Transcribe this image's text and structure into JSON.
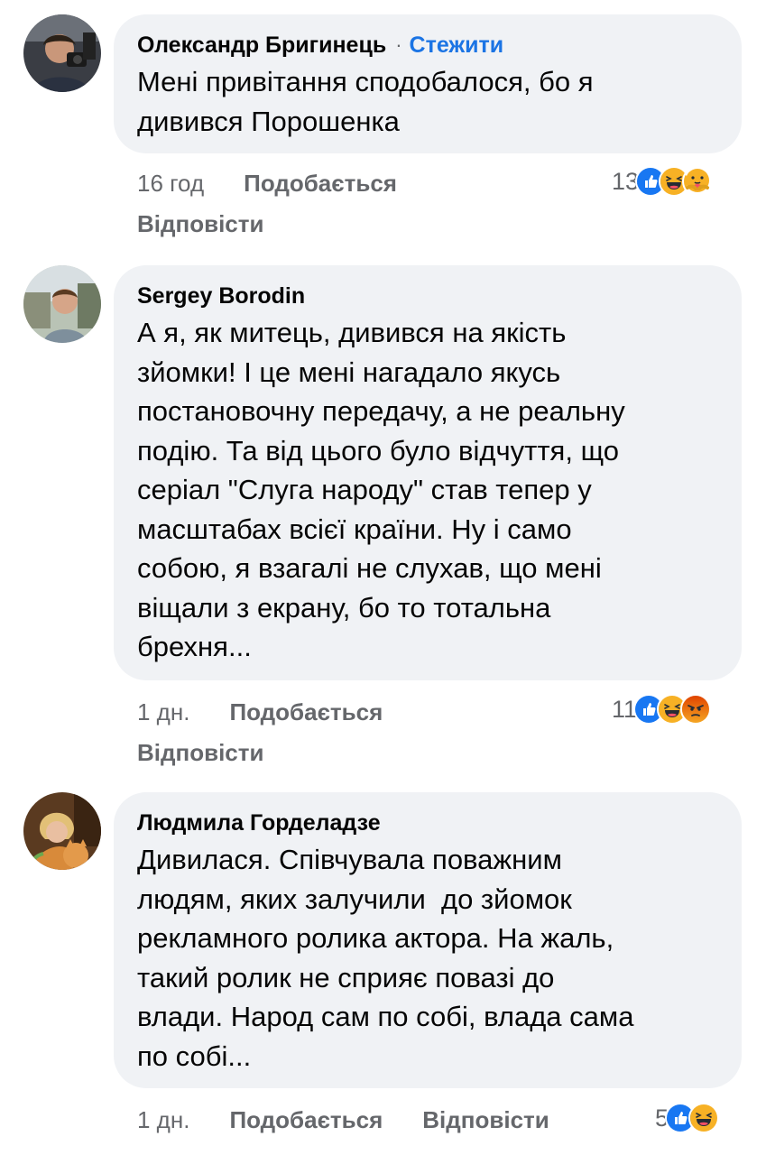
{
  "comments": [
    {
      "author": "Олександр Бригинець",
      "separator": "·",
      "follow": "Стежити",
      "text": "Мені привітання сподобалося, бо я\nдивився Порошенка",
      "time": "16 год",
      "like": "Подобається",
      "reply": "Відповісти",
      "reaction_count": "13",
      "reactions": [
        "like-icon",
        "haha-icon",
        "care-icon"
      ]
    },
    {
      "author": "Sergey Borodin",
      "text": "А я, як митець, дивився на якість\nзйомки! І це мені нагадало якусь\nпостановочну передачу, а не реальну\nподію. Та від цього було відчуття, що\nсеріал \"Слуга народу\" став тепер у\nмасштабах всієї країни. Ну і само\nсобою, я взагалі не слухав, що мені\nвіщали з екрану, бо то тотальна\nбрехня...",
      "time": "1 дн.",
      "like": "Подобається",
      "reply": "Відповісти",
      "reaction_count": "11",
      "reactions": [
        "like-icon",
        "haha-icon",
        "angry-icon"
      ]
    },
    {
      "author": "Людмила Горделадзе",
      "text": "Дивилася. Співчувала поважним\nлюдям, яких залучили  до зйомок\nрекламного ролика актора. На жаль,\nтакий ролик не сприяє повазі до\nвлади. Народ сам по собі, влада сама\nпо собі...",
      "time": "1 дн.",
      "like": "Подобається",
      "reply": "Відповісти",
      "reaction_count": "5",
      "reactions": [
        "like-icon",
        "haha-icon"
      ]
    }
  ],
  "colors": {
    "bubble": "#f0f2f5",
    "meta": "#65676b",
    "follow": "#1b74e4",
    "like_reaction": "#1877f2",
    "haha_reaction": "#f7b125",
    "angry_reaction": "#e9710f"
  }
}
